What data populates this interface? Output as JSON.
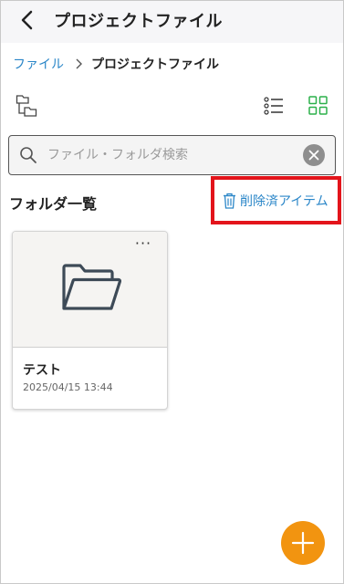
{
  "header": {
    "title": "プロジェクトファイル",
    "back_icon": "chevron-left-icon"
  },
  "breadcrumb": {
    "root": "ファイル",
    "current": "プロジェクトファイル"
  },
  "toolbar": {
    "tree_icon": "folder-tree-icon",
    "list_icon": "list-view-icon",
    "grid_icon": "grid-view-icon",
    "active_view": "grid"
  },
  "search": {
    "placeholder": "ファイル・フォルダ検索",
    "value": ""
  },
  "section": {
    "title": "フォルダ一覧",
    "deleted_items_label": "削除済アイテム"
  },
  "folders": [
    {
      "name": "テスト",
      "date": "2025/04/15 13:44",
      "more": "···"
    }
  ],
  "colors": {
    "accent_blue": "#2a86c8",
    "grid_active": "#2bb04a",
    "highlight_red": "#e3141b",
    "fab_orange": "#f29410"
  }
}
